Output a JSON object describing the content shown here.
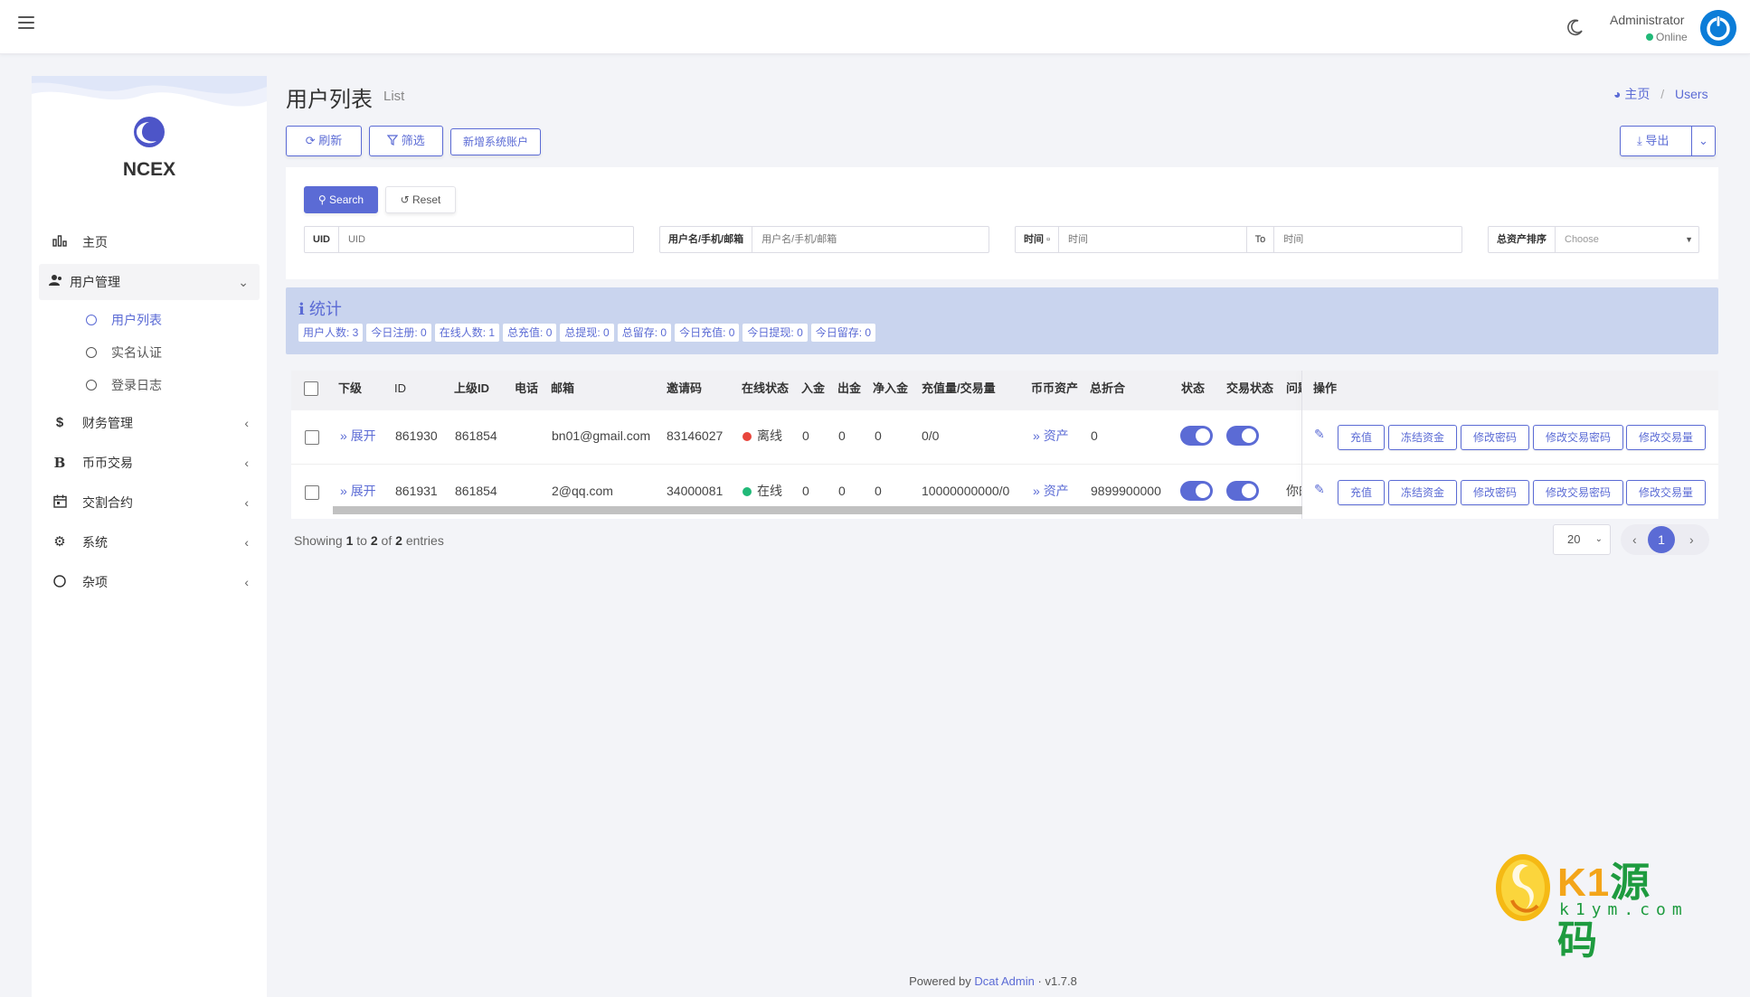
{
  "header": {
    "user_name": "Administrator",
    "user_status": "Online"
  },
  "sidebar": {
    "brand": "NCEX",
    "menu": [
      {
        "label": "主页",
        "icon": "bar-chart-icon"
      },
      {
        "label": "用户管理",
        "icon": "users-icon",
        "expanded": true,
        "children": [
          {
            "label": "用户列表",
            "active": true
          },
          {
            "label": "实名认证"
          },
          {
            "label": "登录日志"
          }
        ]
      },
      {
        "label": "财务管理",
        "icon": "dollar-icon"
      },
      {
        "label": "币币交易",
        "icon": "bitcoin-icon"
      },
      {
        "label": "交割合约",
        "icon": "calendar-icon"
      },
      {
        "label": "系统",
        "icon": "gear-icon"
      },
      {
        "label": "杂项",
        "icon": "circle-icon"
      }
    ]
  },
  "page": {
    "title": "用户列表",
    "subtitle": "List",
    "breadcrumb": {
      "home": "主页",
      "current": "Users"
    }
  },
  "toolbar": {
    "refresh": "刷新",
    "filter": "筛选",
    "add_system_account": "新增系统账户",
    "export": "导出"
  },
  "filters": {
    "search_button": "Search",
    "reset_button": "Reset",
    "uid_label": "UID",
    "uid_placeholder": "UID",
    "user_label": "用户名/手机/邮箱",
    "user_placeholder": "用户名/手机/邮箱",
    "time_label": "时间",
    "time_placeholder_start": "时间",
    "time_to": "To",
    "time_placeholder_end": "时间",
    "sort_label": "总资产排序",
    "sort_placeholder": "Choose"
  },
  "stats": {
    "title": "统计",
    "items": [
      "用户人数: 3",
      "今日注册: 0",
      "在线人数: 1",
      "总充值: 0",
      "总提现: 0",
      "总留存: 0",
      "今日充值: 0",
      "今日提现: 0",
      "今日留存: 0"
    ]
  },
  "table": {
    "columns": [
      "下级",
      "ID",
      "上级ID",
      "电话",
      "邮箱",
      "邀请码",
      "在线状态",
      "入金",
      "出金",
      "净入金",
      "充值量/交易量",
      "币币资产",
      "总折合",
      "状态",
      "交易状态",
      "问题",
      "操作"
    ],
    "rows": [
      {
        "expand": "展开",
        "id": "861930",
        "parent_id": "861854",
        "phone": "",
        "email": "bn01@gmail.com",
        "invite_code": "83146027",
        "online": "离线",
        "online_color": "#e8453c",
        "deposit": "0",
        "withdraw": "0",
        "net": "0",
        "volume": "0/0",
        "assets": "资产",
        "total": "0",
        "question": ""
      },
      {
        "expand": "展开",
        "id": "861931",
        "parent_id": "861854",
        "phone": "",
        "email": "2@qq.com",
        "invite_code": "34000081",
        "online": "在线",
        "online_color": "#21b978",
        "deposit": "0",
        "withdraw": "0",
        "net": "0",
        "volume": "10000000000/0",
        "assets": "资产",
        "total": "9899900000",
        "question": "你的"
      }
    ],
    "actions": [
      "充值",
      "冻结资金",
      "修改密码",
      "修改交易密码",
      "修改交易量"
    ]
  },
  "pagination": {
    "showing_prefix": "Showing",
    "from": "1",
    "to_word": "to",
    "to": "2",
    "of_word": "of",
    "total": "2",
    "entries_word": "entries",
    "per_page": "20",
    "current_page": "1"
  },
  "footer": {
    "powered_by": "Powered by",
    "product": "Dcat Admin",
    "separator": "·",
    "version": "v1.7.8"
  },
  "watermark": {
    "main": "K1源码",
    "sub": "k1ym.com"
  },
  "colors": {
    "primary": "#5b6bd5",
    "online": "#21b978",
    "offline": "#e8453c",
    "stats_bg": "#c9d4ee"
  }
}
